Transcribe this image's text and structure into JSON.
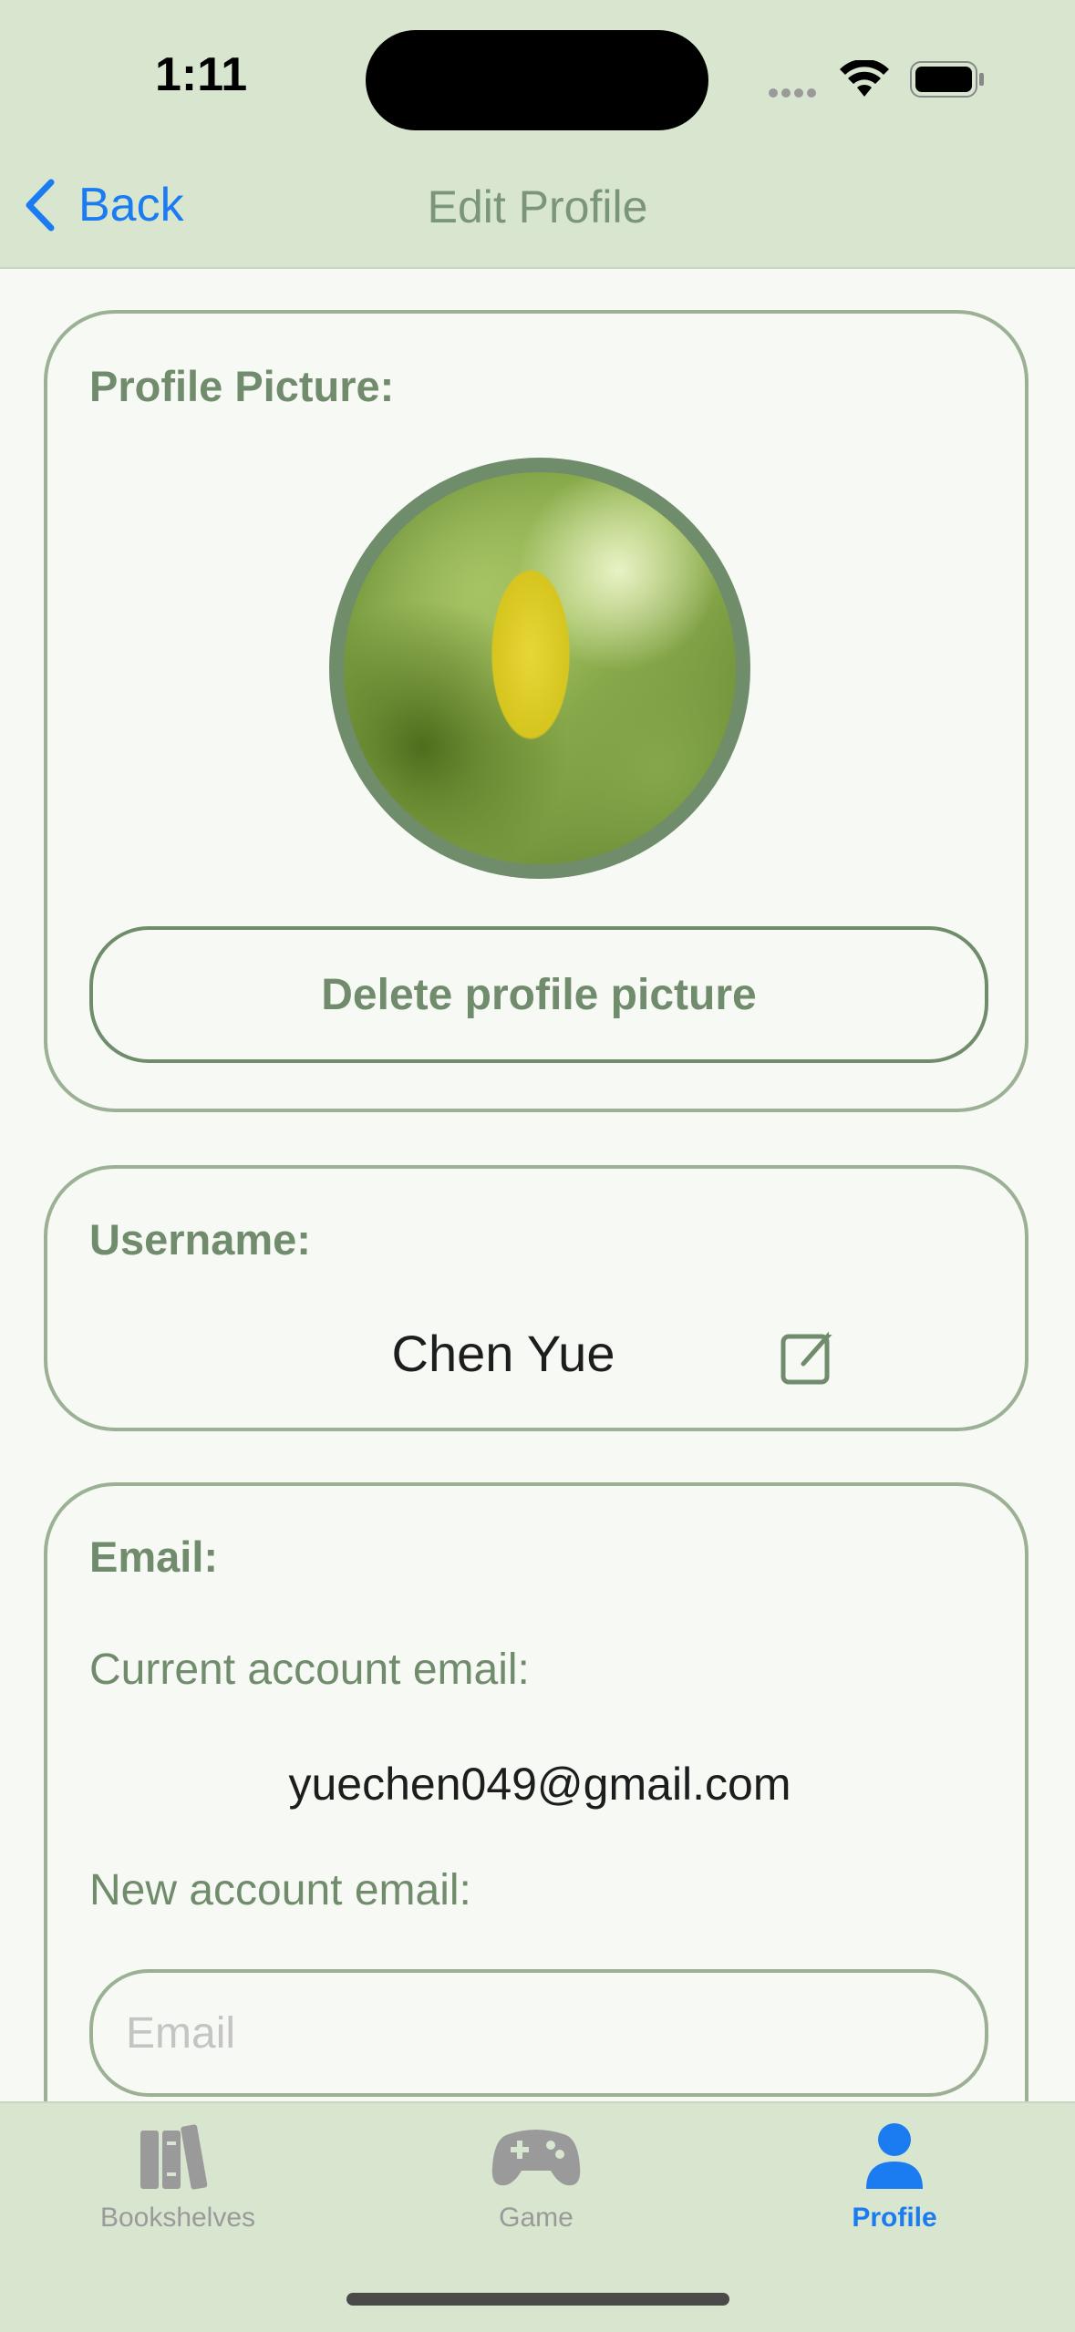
{
  "status_bar": {
    "time": "1:11"
  },
  "nav": {
    "back_label": "Back",
    "title": "Edit Profile"
  },
  "profile_picture": {
    "label": "Profile Picture:",
    "delete_label": "Delete profile picture"
  },
  "username": {
    "label": "Username:",
    "value": "Chen Yue"
  },
  "email": {
    "label": "Email:",
    "current_label": "Current account email:",
    "current_value": "yuechen049@gmail.com",
    "new_label": "New account email:",
    "new_placeholder": "Email",
    "new_value": ""
  },
  "tabs": [
    {
      "label": "Bookshelves",
      "icon": "books-icon",
      "active": false
    },
    {
      "label": "Game",
      "icon": "gamepad-icon",
      "active": false
    },
    {
      "label": "Profile",
      "icon": "person-icon",
      "active": true
    }
  ],
  "colors": {
    "accent": "#1b7bf0",
    "bar_bg": "#d8e6d0",
    "green_text": "#708c6c",
    "card_border": "#9bb095"
  }
}
